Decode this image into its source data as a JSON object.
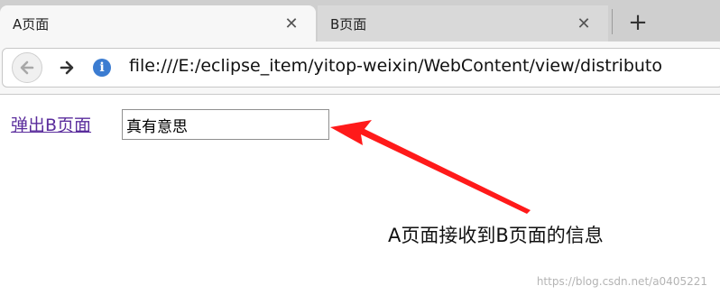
{
  "tabs": [
    {
      "label": "A页面",
      "active": true
    },
    {
      "label": "B页面",
      "active": false
    }
  ],
  "new_tab_icon": "plus-icon",
  "close_icon": "close-icon",
  "toolbar": {
    "back_icon": "arrow-left-icon",
    "forward_icon": "arrow-right-icon",
    "info_icon": "info-icon",
    "info_glyph": "i",
    "url": "file:///E:/eclipse_item/yitop-weixin/WebContent/view/distributo"
  },
  "page": {
    "link_label": "弹出B页面",
    "input_value": "真有意思",
    "annotation": "A页面接收到B页面的信息",
    "watermark": "https://blog.csdn.net/a0405221"
  },
  "colors": {
    "link": "#5a2c9c",
    "arrow": "#ff1a1a",
    "info": "#3b7cd1"
  }
}
